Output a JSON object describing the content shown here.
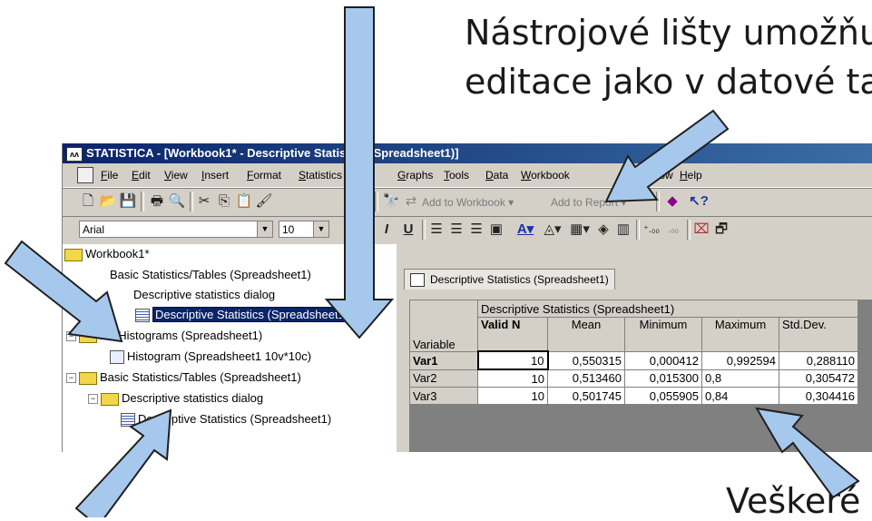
{
  "captions": {
    "line1": "Nástrojové lišty umožňu",
    "line2": "editace jako v datové ta",
    "line3": "Veškeré"
  },
  "window": {
    "title": "STATISTICA - [Workbook1* - Descriptive Statistics (Spreadsheet1)]",
    "menu": [
      "File",
      "Edit",
      "View",
      "Insert",
      "Format",
      "Statistics",
      "Graphs",
      "Tools",
      "Data",
      "Workbook",
      "Window",
      "Help"
    ],
    "toolbar": {
      "add_to_workbook": "Add to Workbook ▾",
      "add_to_report": "Add to Report ▾"
    },
    "format": {
      "font": "Arial",
      "size": "10"
    }
  },
  "tree": {
    "root": "Workbook1*",
    "n1": "Basic Statistics/Tables (Spreadsheet1)",
    "n1a": "Descriptive statistics dialog",
    "n1b": "Descriptive Statistics (Spreadsheet1)",
    "n2": "2D Histograms (Spreadsheet1)",
    "n2a": "Histogram (Spreadsheet1 10v*10c)",
    "n3": "Basic Statistics/Tables (Spreadsheet1)",
    "n3a": "Descriptive statistics dialog",
    "n3b": "Descriptive Statistics (Spreadsheet1)"
  },
  "sheet": {
    "tab": "Descriptive Statistics (Spreadsheet1)",
    "title": "Descriptive Statistics (Spreadsheet1)",
    "headers": [
      "Valid N",
      "Mean",
      "Minimum",
      "Maximum",
      "Std.Dev."
    ],
    "rowheader": "Variable",
    "rows": [
      {
        "name": "Var1",
        "cells": [
          "10",
          "0,550315",
          "0,000412",
          "0,992594",
          "0,288110"
        ]
      },
      {
        "name": "Var2",
        "cells": [
          "10",
          "0,513460",
          "0,015300",
          "0,8",
          "0,305472"
        ]
      },
      {
        "name": "Var3",
        "cells": [
          "10",
          "0,501745",
          "0,055905",
          "0,84",
          "0,304416"
        ]
      }
    ]
  },
  "colors": {
    "arrow_fill": "#a6c8ec",
    "arrow_stroke": "#1f1f1f",
    "titlebar": "#0a246a",
    "chrome": "#d4d0c8"
  }
}
